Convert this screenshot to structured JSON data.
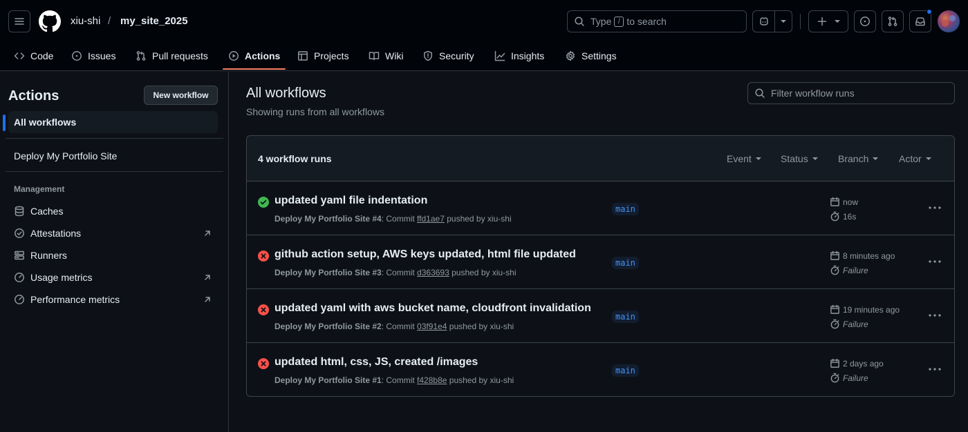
{
  "header": {
    "owner": "xiu-shi",
    "separator": "/",
    "repo": "my_site_2025",
    "search": {
      "prefix": "Type",
      "key": "/",
      "suffix": "to search"
    },
    "notification_dot_color": "#1f6feb"
  },
  "tabs": [
    {
      "label": "Code",
      "icon": "code-icon"
    },
    {
      "label": "Issues",
      "icon": "issue-icon"
    },
    {
      "label": "Pull requests",
      "icon": "pull-request-icon"
    },
    {
      "label": "Actions",
      "icon": "play-icon",
      "active": true
    },
    {
      "label": "Projects",
      "icon": "table-icon"
    },
    {
      "label": "Wiki",
      "icon": "book-icon"
    },
    {
      "label": "Security",
      "icon": "shield-icon"
    },
    {
      "label": "Insights",
      "icon": "graph-icon"
    },
    {
      "label": "Settings",
      "icon": "gear-icon"
    }
  ],
  "sidebar": {
    "title": "Actions",
    "new_workflow": "New workflow",
    "all_workflows": "All workflows",
    "workflows": [
      "Deploy My Portfolio Site"
    ],
    "management_label": "Management",
    "management": [
      {
        "label": "Caches",
        "icon": "database-icon",
        "external": false
      },
      {
        "label": "Attestations",
        "icon": "verified-icon",
        "external": true
      },
      {
        "label": "Runners",
        "icon": "server-icon",
        "external": false
      },
      {
        "label": "Usage metrics",
        "icon": "meter-icon",
        "external": true
      },
      {
        "label": "Performance metrics",
        "icon": "meter-icon",
        "external": true
      }
    ]
  },
  "main": {
    "title": "All workflows",
    "subtitle": "Showing runs from all workflows",
    "filter_placeholder": "Filter workflow runs",
    "runs_count": "4 workflow runs",
    "filters": [
      "Event",
      "Status",
      "Branch",
      "Actor"
    ],
    "runs": [
      {
        "status": "success",
        "title": "updated yaml file indentation",
        "workflow": "Deploy My Portfolio Site #4",
        "commit_label": ": Commit",
        "sha": "ffd1ae7",
        "pushed_by": "pushed by xiu-shi",
        "branch": "main",
        "time": "now",
        "duration": "16s"
      },
      {
        "status": "failure",
        "title": "github action setup, AWS keys updated, html file updated",
        "workflow": "Deploy My Portfolio Site #3",
        "commit_label": ": Commit",
        "sha": "d363693",
        "pushed_by": "pushed by xiu-shi",
        "branch": "main",
        "time": "8 minutes ago",
        "duration": "Failure"
      },
      {
        "status": "failure",
        "title": "updated yaml with aws bucket name, cloudfront invalidation",
        "workflow": "Deploy My Portfolio Site #2",
        "commit_label": ": Commit",
        "sha": "03f91e4",
        "pushed_by": "pushed by xiu-shi",
        "branch": "main",
        "time": "19 minutes ago",
        "duration": "Failure"
      },
      {
        "status": "failure",
        "title": "updated html, css, JS, created /images",
        "workflow": "Deploy My Portfolio Site #1",
        "commit_label": ": Commit",
        "sha": "f428b8e",
        "pushed_by": "pushed by xiu-shi",
        "branch": "main",
        "time": "2 days ago",
        "duration": "Failure"
      }
    ]
  },
  "colors": {
    "success": "#3fb950",
    "failure": "#f85149",
    "accent": "#1f6feb",
    "tab_underline": "#f78166"
  }
}
